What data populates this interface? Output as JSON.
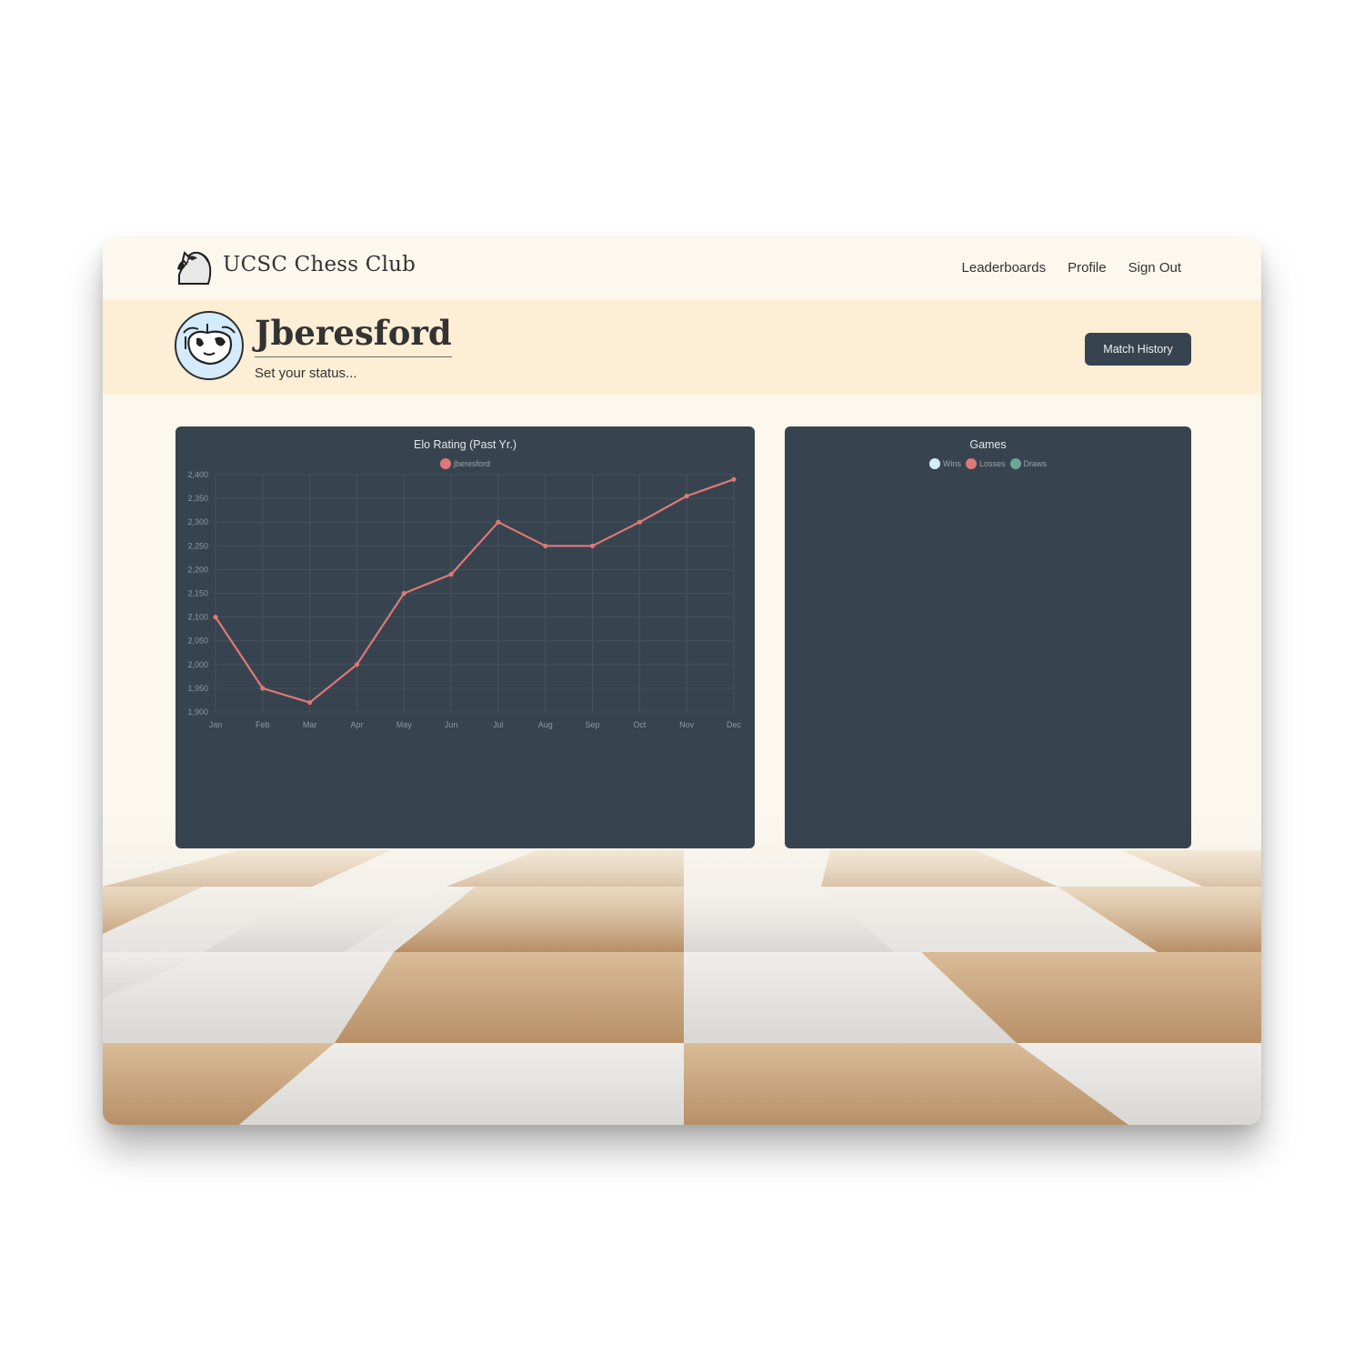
{
  "header": {
    "brand": "UCSC Chess Club",
    "nav": [
      "Leaderboards",
      "Profile",
      "Sign Out"
    ]
  },
  "profile": {
    "username": "Jberesford",
    "status_placeholder": "Set your status...",
    "match_history_label": "Match History"
  },
  "colors": {
    "panel": "#37444f",
    "line": "#e07878",
    "wins": "#d6ecfb",
    "losses": "#e07878",
    "draws": "#6aa893"
  },
  "games": {
    "title": "Games",
    "legend": [
      "Wins",
      "Losses",
      "Draws"
    ]
  },
  "chart_data": {
    "type": "line",
    "title": "Elo Rating (Past Yr.)",
    "x": [
      "Jan",
      "Feb",
      "Mar",
      "Apr",
      "May",
      "Jun",
      "Jul",
      "Aug",
      "Sep",
      "Oct",
      "Nov",
      "Dec"
    ],
    "series": [
      {
        "name": "jberesford",
        "values": [
          2100,
          1950,
          1920,
          2000,
          2150,
          2190,
          2300,
          2250,
          2250,
          2300,
          2355,
          2390
        ]
      }
    ],
    "yticks": [
      "2,400",
      "2,350",
      "2,300",
      "2,250",
      "2,200",
      "2,150",
      "2,100",
      "2,050",
      "2,000",
      "1,950",
      "1,900"
    ],
    "ylim": [
      1900,
      2400
    ],
    "grid": true,
    "legend_position": "top"
  }
}
